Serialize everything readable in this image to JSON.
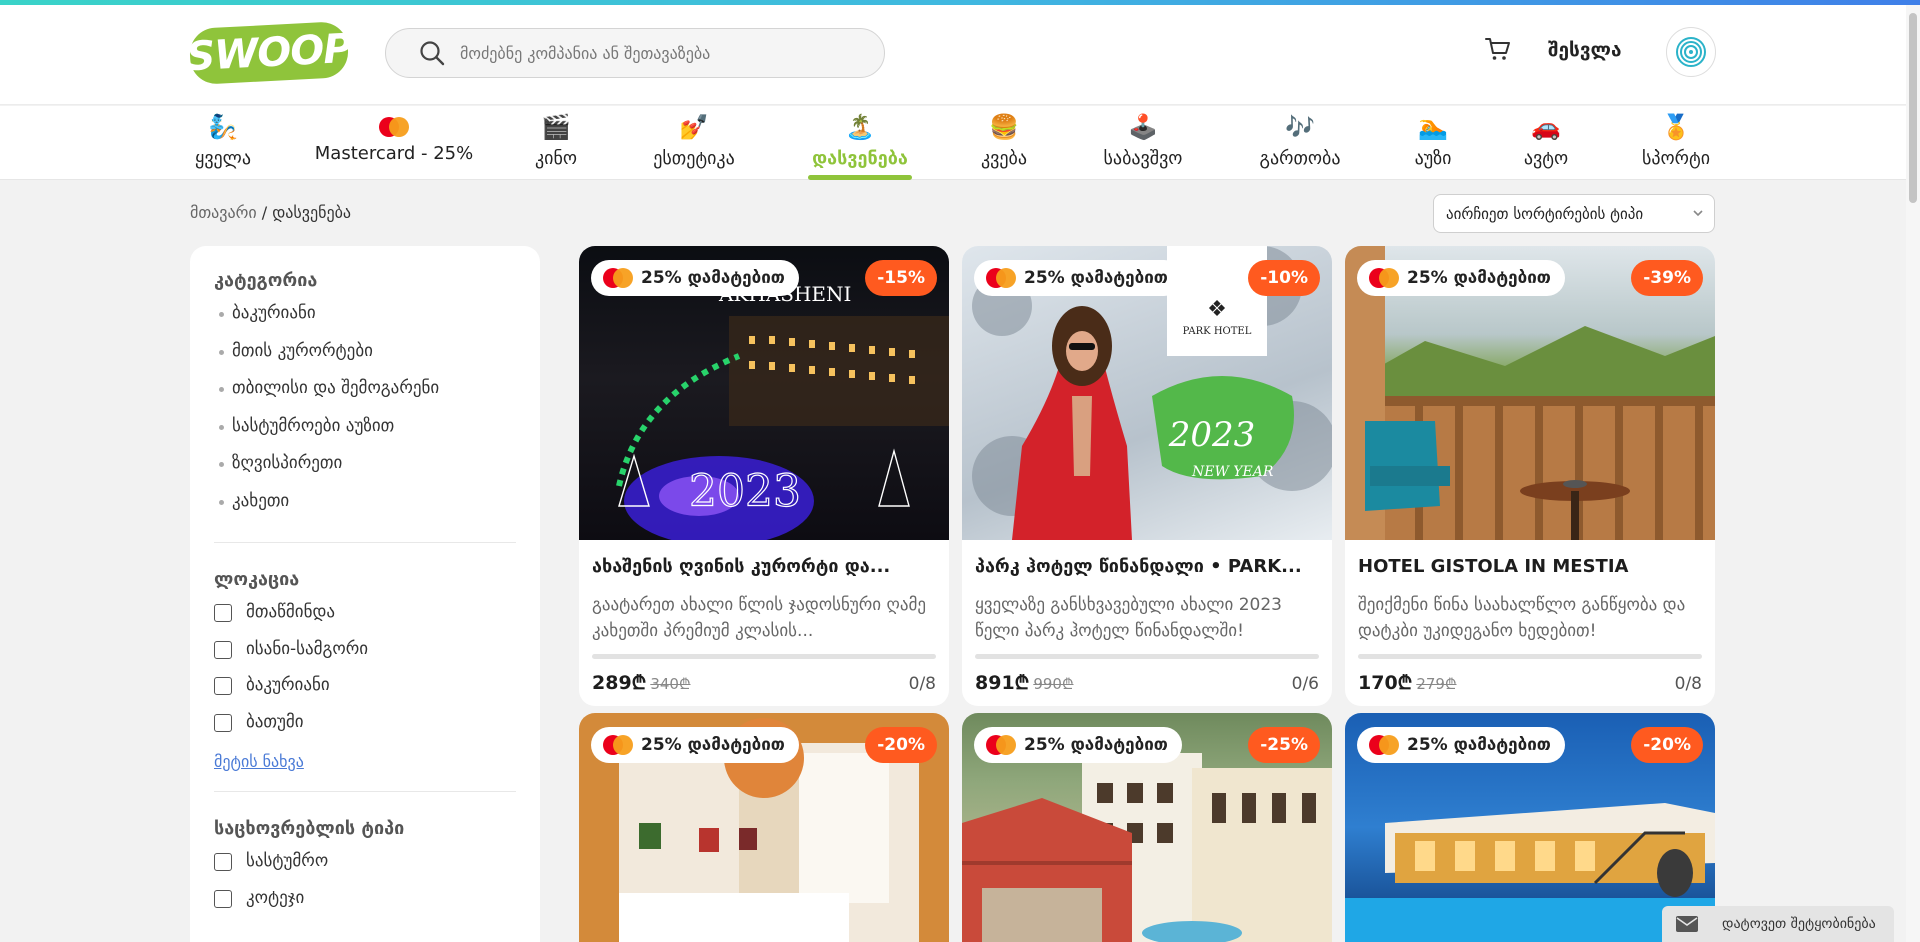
{
  "header": {
    "logo_text": "SWOOP",
    "search_placeholder": "მოძებნე კომპანია ან შეთავაზება",
    "login_label": "შესვლა"
  },
  "categories": [
    {
      "label": "ყველა",
      "icon": "genie-lamp-icon",
      "emoji": "🧞"
    },
    {
      "label": "Mastercard - 25%",
      "icon": "mastercard-icon",
      "emoji": ""
    },
    {
      "label": "კინო",
      "icon": "clapperboard-icon",
      "emoji": "🎬"
    },
    {
      "label": "ესთეტიკა",
      "icon": "nail-polish-icon",
      "emoji": "💅"
    },
    {
      "label": "დასვენება",
      "icon": "island-icon",
      "emoji": "🏝️",
      "active": true
    },
    {
      "label": "კვება",
      "icon": "burger-icon",
      "emoji": "🍔"
    },
    {
      "label": "საბავშვო",
      "icon": "joystick-icon",
      "emoji": "🕹️"
    },
    {
      "label": "გართობა",
      "icon": "music-notes-icon",
      "emoji": "🎶"
    },
    {
      "label": "აუზი",
      "icon": "swimmer-icon",
      "emoji": "🏊"
    },
    {
      "label": "ავტო",
      "icon": "car-icon",
      "emoji": "🚗"
    },
    {
      "label": "სპორტი",
      "icon": "medal-icon",
      "emoji": "🏅"
    }
  ],
  "breadcrumb": {
    "home": "მთავარი",
    "current": "/ დასვენება"
  },
  "sort": {
    "label": "აირჩიეთ სორტირების ტიპი"
  },
  "sidebar": {
    "category_title": "კატეგორია",
    "category_items": [
      "ბაკურიანი",
      "მთის კურორტები",
      "თბილისი და შემოგარენი",
      "სასტუმროები აუზით",
      "ზღვისპირეთი",
      "კახეთი"
    ],
    "location_title": "ლოკაცია",
    "location_items": [
      "მთაწმინდა",
      "ისანი-სამგორი",
      "ბაკურიანი",
      "ბათუმი"
    ],
    "more_label": "მეტის ნახვა",
    "type_title": "საცხოვრებლის ტიპი",
    "type_items": [
      "სასტუმრო",
      "კოტეჯი"
    ]
  },
  "cards": [
    {
      "badge": "25% დამატებით",
      "discount": "-15%",
      "title": "ახაშენის ღვინის კურორტი და...",
      "desc": "გაატარეთ ახალი წლის ჯადოსნური ღამე კახეთში პრემიუმ კლასის...",
      "price": "289₾",
      "old_price": "340₾",
      "count": "0/8",
      "sold_fraction": 0
    },
    {
      "badge": "25% დამატებით",
      "discount": "-10%",
      "title": "პარკ ჰოტელ წინანდალი • PARK...",
      "desc": "ყველაზე განსხვავებული ახალი 2023 წელი პარკ ჰოტელ წინანდალში!",
      "price": "891₾",
      "old_price": "990₾",
      "count": "0/6",
      "sold_fraction": 0
    },
    {
      "badge": "25% დამატებით",
      "discount": "-39%",
      "title": "HOTEL GISTOLA IN MESTIA",
      "desc": "შეიქმენი წინა საახალწლო განწყობა და დატკბი უკიდეგანო ხედებით!",
      "price": "170₾",
      "old_price": "279₾",
      "count": "0/8",
      "sold_fraction": 0
    },
    {
      "badge": "25% დამატებით",
      "discount": "-20%"
    },
    {
      "badge": "25% დამატებით",
      "discount": "-25%"
    },
    {
      "badge": "25% დამატებით",
      "discount": "-20%"
    }
  ],
  "image_texts": {
    "card1_brand": "AKHASHENI",
    "card1_year": "2023",
    "card2_brand": "PARK HOTEL",
    "card2_year": "2023",
    "card2_caption": "NEW YEAR"
  },
  "chat": {
    "label": "დატოვეთ შეტყობინება"
  }
}
